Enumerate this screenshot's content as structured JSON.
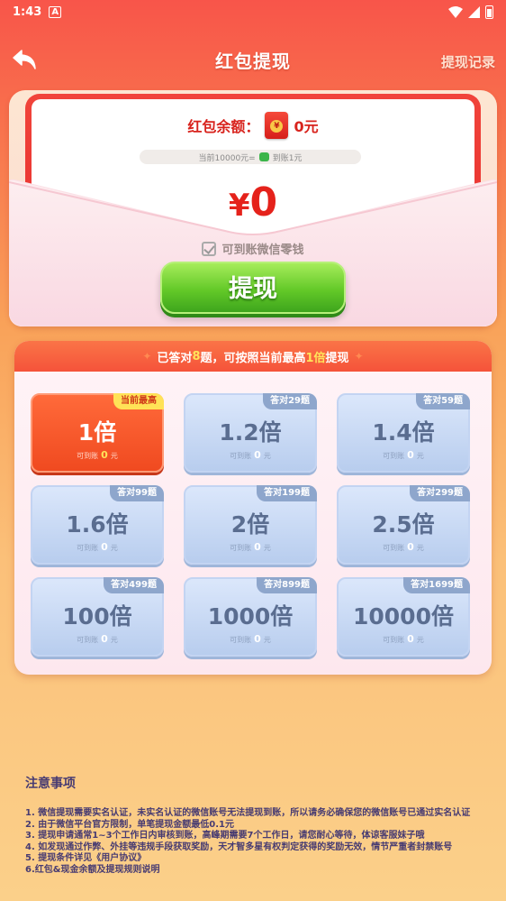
{
  "status_bar": {
    "time": "1:43",
    "notif_icon": "A"
  },
  "nav": {
    "title": "红包提现",
    "record_link": "提现记录",
    "back_icon": "back-arrow-icon"
  },
  "envelope": {
    "balance_label": "红包余额：",
    "balance_value": "0元",
    "rate_left": "当前10000元=",
    "rate_right": "到账1元",
    "amount_symbol": "¥",
    "amount_value": "0",
    "wechat_note": "可到账微信零钱",
    "withdraw_button": "提现"
  },
  "panel": {
    "header_prefix": "已答对",
    "header_count": "8",
    "header_mid": "题，可按照当前最高",
    "header_mult": "1倍",
    "header_suffix": "提现",
    "sub_prefix": "可到账",
    "sub_zero": "0",
    "sub_suffix": "元",
    "tiles": [
      {
        "tag": "当前最高",
        "mult": "1倍",
        "active": true
      },
      {
        "tag": "答对29题",
        "mult": "1.2倍"
      },
      {
        "tag": "答对59题",
        "mult": "1.4倍"
      },
      {
        "tag": "答对99题",
        "mult": "1.6倍"
      },
      {
        "tag": "答对199题",
        "mult": "2倍"
      },
      {
        "tag": "答对299题",
        "mult": "2.5倍"
      },
      {
        "tag": "答对499题",
        "mult": "100倍"
      },
      {
        "tag": "答对899题",
        "mult": "1000倍"
      },
      {
        "tag": "答对1699题",
        "mult": "10000倍"
      }
    ]
  },
  "notes": {
    "title": "注意事项",
    "items": [
      "1. 微信提现需要实名认证，未实名认证的微信账号无法提现到账，所以请务必确保您的微信账号已通过实名认证",
      "2. 由于微信平台官方限制，单笔提现金额最低0.1元",
      "3. 提现申请通常1~3个工作日内审核到账，高峰期需要7个工作日，请您耐心等待，体谅客服妹子哦",
      "4. 如发现通过作弊、外挂等违规手段获取奖励，天才智多星有权判定获得的奖励无效，情节严重者封禁账号",
      "5. 提现条件详见《用户协议》",
      "6.红包&现金余额及提现规则说明"
    ]
  }
}
